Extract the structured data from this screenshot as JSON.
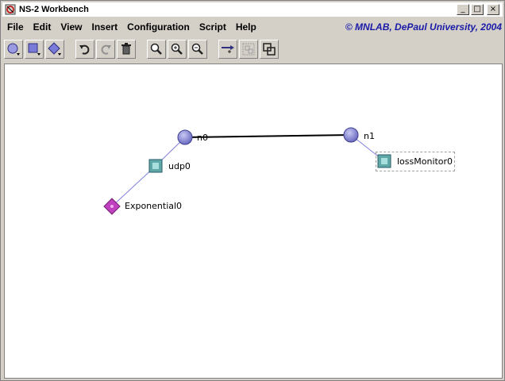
{
  "window": {
    "title": "NS-2 Workbench",
    "minimize_glyph": "_",
    "maximize_glyph": "□",
    "close_glyph": "×"
  },
  "menu": {
    "file": "File",
    "edit": "Edit",
    "view": "View",
    "insert": "Insert",
    "configuration": "Configuration",
    "script": "Script",
    "help": "Help"
  },
  "copyright": "© MNLAB, DePaul University, 2004",
  "toolbar": {
    "icons": [
      "node-tool-icon",
      "agent-tool-icon",
      "traffic-tool-icon",
      "undo-icon",
      "redo-icon",
      "delete-icon",
      "zoom-icon",
      "zoom-in-icon",
      "zoom-out-icon",
      "add-link-icon",
      "group-icon",
      "ungroup-icon"
    ]
  },
  "network": {
    "nodes": [
      {
        "label": "n0"
      },
      {
        "label": "n1"
      }
    ],
    "agents": [
      {
        "label": "udp0"
      },
      {
        "label": "lossMonitor0"
      }
    ],
    "traffic": [
      {
        "label": "Exponential0"
      }
    ]
  },
  "colors": {
    "node": "#8b8bd8",
    "agent": "#5ea8a8",
    "traffic": "#c040c0",
    "attach_line": "#8080e0",
    "copyright": "#1a1aa8"
  }
}
